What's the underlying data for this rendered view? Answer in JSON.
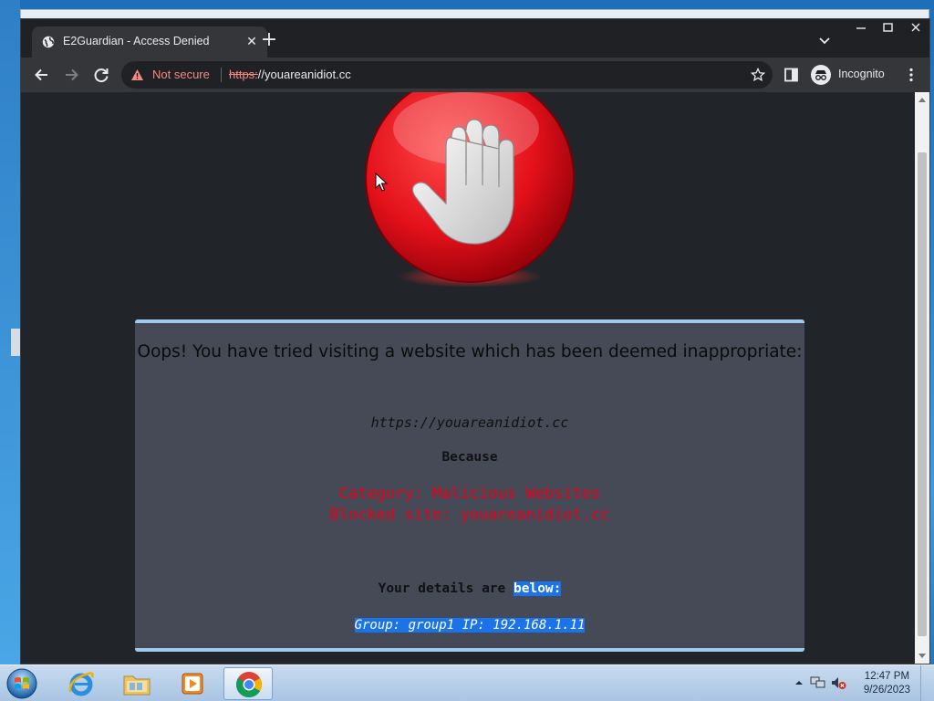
{
  "browser": {
    "tab_title": "E2Guardian - Access Denied",
    "security_label": "Not secure",
    "url_scheme": "https:",
    "url_rest": "//youareanidiot.cc",
    "profile_label": "Incognito"
  },
  "page": {
    "headline": "Oops! You have tried visiting a website which has been deemed inappropriate:",
    "blocked_url": "https://youareanidiot.cc",
    "because_label": "Because",
    "category": "Category: Malicious Websites",
    "blocked_site": "Blocked site: youareanidiot.cc",
    "details_prefix": "Your details are ",
    "details_highlight": "below: ",
    "group_info": "Group: group1  IP: 192.168.1.11"
  },
  "taskbar": {
    "time": "12:47 PM",
    "date": "9/26/2023",
    "apps": [
      "internet-explorer",
      "file-explorer",
      "media-player",
      "chrome"
    ]
  },
  "colors": {
    "panel_bg": "#454a56",
    "panel_border": "#9fc9ef",
    "reason_text": "#e8001b",
    "page_bg": "#212529",
    "selection": "#1a73e8"
  }
}
